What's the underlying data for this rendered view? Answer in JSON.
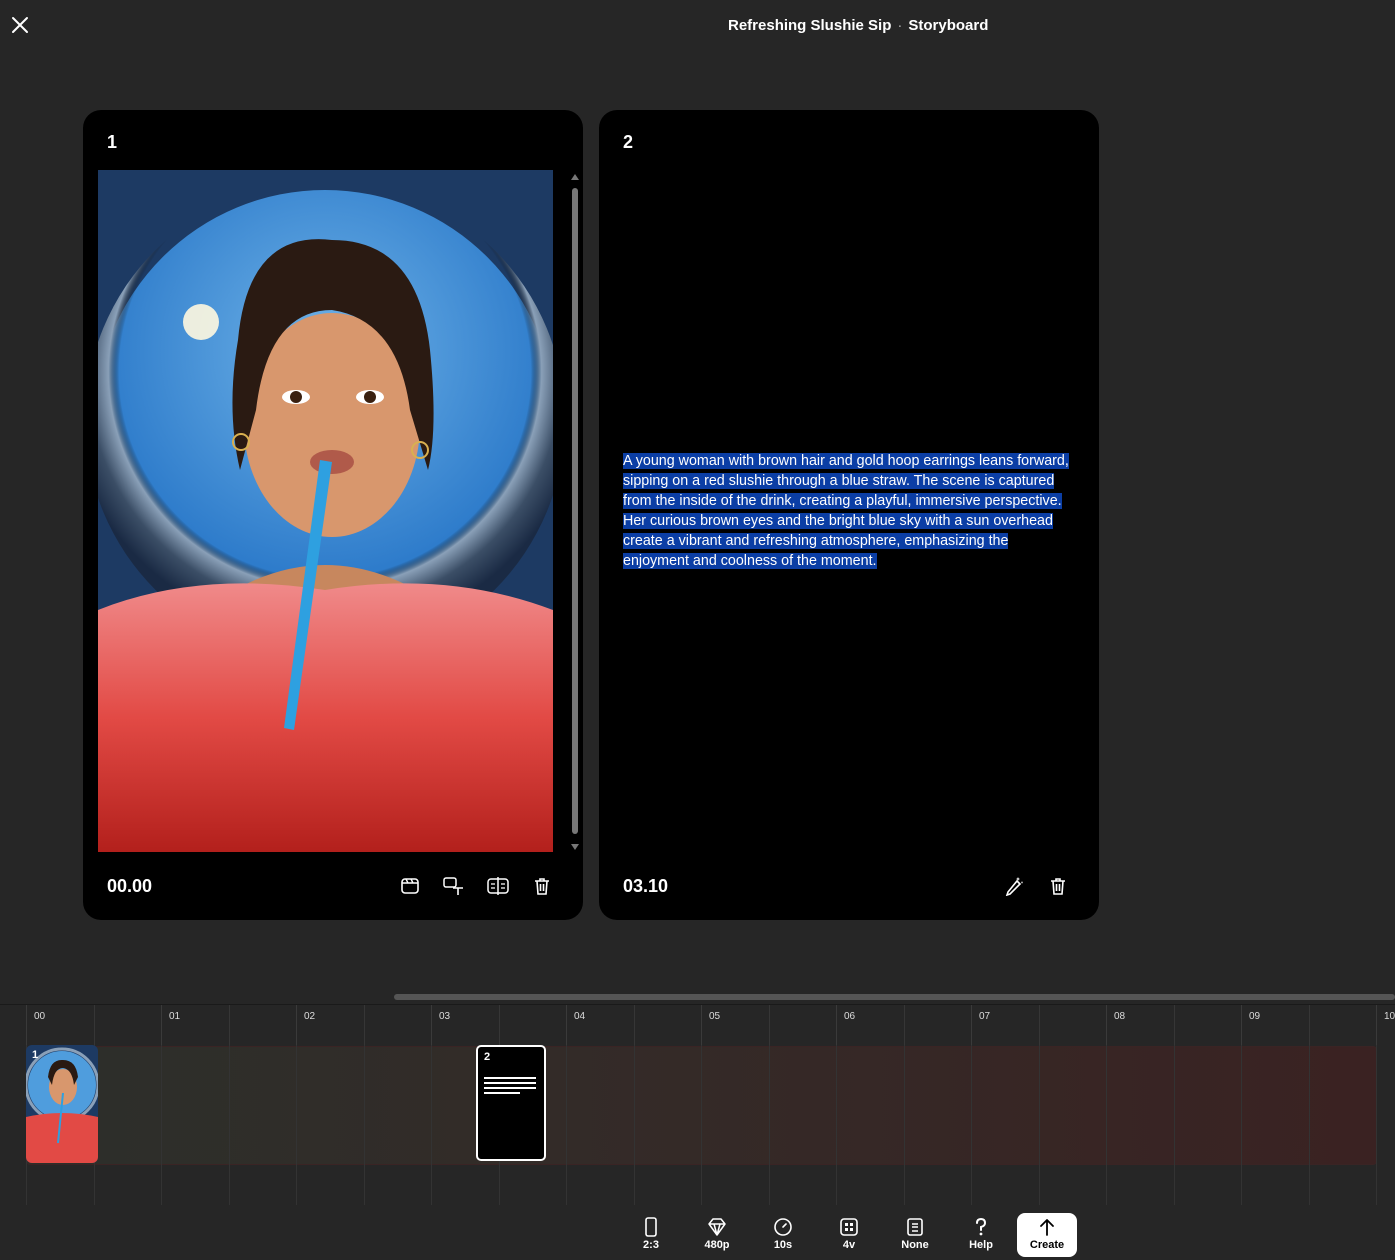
{
  "header": {
    "title": "Refreshing Slushie Sip",
    "separator": "·",
    "subtitle": "Storyboard"
  },
  "cards": [
    {
      "number": "1",
      "time": "00.00",
      "tools": [
        "gallery-icon",
        "text-swap-icon",
        "split-icon",
        "trash-icon"
      ]
    },
    {
      "number": "2",
      "time": "03.10",
      "prompt": "A young woman with brown hair and gold hoop earrings leans forward, sipping on a red slushie through a blue straw. The scene is captured from the inside of the drink, creating a playful, immersive perspective. Her curious brown eyes and the bright blue sky with a sun overhead create a vibrant and refreshing atmosphere, emphasizing the enjoyment and coolness of the moment.",
      "tools": [
        "magic-pencil-icon",
        "trash-icon"
      ]
    }
  ],
  "timeline": {
    "labels": [
      "00",
      "01",
      "02",
      "03",
      "04",
      "05",
      "06",
      "07",
      "08",
      "09",
      "10"
    ],
    "clips": [
      {
        "number": "1"
      },
      {
        "number": "2"
      }
    ]
  },
  "toolbar": {
    "items": [
      {
        "label": "2:3",
        "icon": "phone-aspect-icon"
      },
      {
        "label": "480p",
        "icon": "diamond-icon"
      },
      {
        "label": "10s",
        "icon": "clock-icon"
      },
      {
        "label": "4v",
        "icon": "grid-icon"
      },
      {
        "label": "None",
        "icon": "preset-icon"
      },
      {
        "label": "Help",
        "icon": "question-icon"
      },
      {
        "label": "Create",
        "icon": "arrow-up-icon"
      }
    ]
  },
  "colors": {
    "background": "#262626",
    "card": "#000000",
    "selection": "#0b3ea5"
  }
}
